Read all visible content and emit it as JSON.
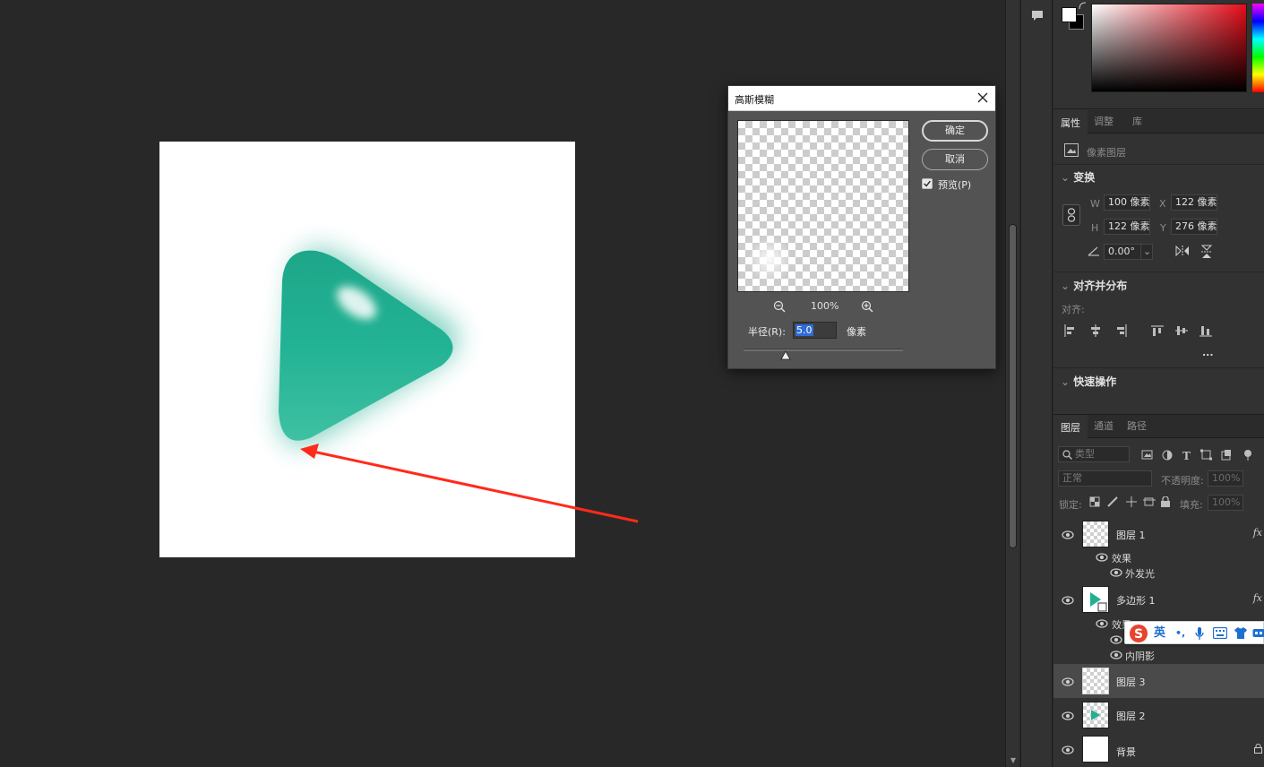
{
  "dialog": {
    "title": "高斯模糊",
    "ok_label": "确定",
    "cancel_label": "取消",
    "preview_label": "预览(P)",
    "preview_checked": true,
    "zoom": "100%",
    "radius_label": "半径(R):",
    "radius_value": "5.0",
    "radius_unit": "像素"
  },
  "properties": {
    "tabs": [
      "属性",
      "调整",
      "库"
    ],
    "active_tab": "属性",
    "layer_type": "像素图层",
    "transform_title": "变换",
    "w_label": "W",
    "w_value": "100 像素",
    "x_label": "X",
    "x_value": "122 像素",
    "h_label": "H",
    "h_value": "122 像素",
    "y_label": "Y",
    "y_value": "276 像素",
    "angle_value": "0.00°",
    "align_title": "对齐并分布",
    "align_label": "对齐:",
    "more": "...",
    "quick_title": "快速操作"
  },
  "layers": {
    "tabs": [
      "图层",
      "通道",
      "路径"
    ],
    "active_tab": "图层",
    "search_placeholder": "类型",
    "blend_mode": "正常",
    "opacity_label": "不透明度:",
    "opacity_value": "100%",
    "lock_label": "锁定:",
    "fill_label": "填充:",
    "fill_value": "100%",
    "items": [
      {
        "name": "图层 1",
        "fx": "fx",
        "effects_label": "效果",
        "effects": [
          "外发光"
        ]
      },
      {
        "name": "多边形 1",
        "fx": "fx",
        "effects_label": "效果",
        "effects": [
          "",
          "内阴影"
        ]
      },
      {
        "name": "图层 3",
        "selected": true
      },
      {
        "name": "图层 2"
      },
      {
        "name": "背景"
      }
    ]
  },
  "ime": {
    "lang": "英",
    "punct": "•,"
  },
  "colors": {
    "triangle": "#20b092",
    "arrow": "#ff2a1a",
    "selection": "#2f6cd6"
  }
}
